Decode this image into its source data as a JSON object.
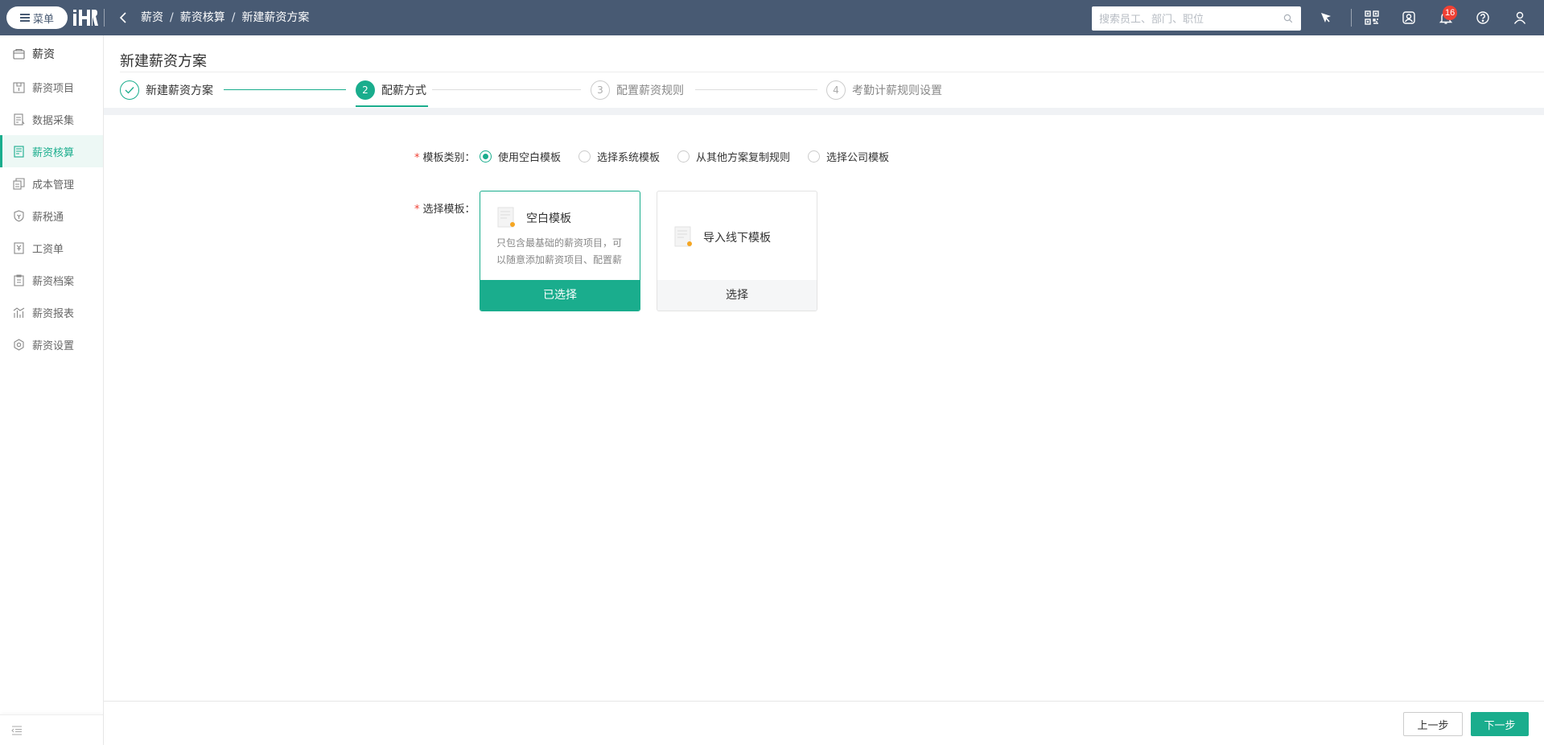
{
  "topbar": {
    "menu_label": "菜单",
    "breadcrumb": [
      "薪资",
      "薪资核算",
      "新建薪资方案"
    ],
    "breadcrumb_sep": "/",
    "search_placeholder": "搜索员工、部门、职位",
    "notification_count": "16",
    "icons": [
      "menu-icon",
      "back-icon",
      "search-icon",
      "pin-icon",
      "qrcode-icon",
      "contacts-icon",
      "bell-icon",
      "help-icon",
      "user-icon"
    ]
  },
  "sidebar": {
    "items": [
      {
        "label": "薪资",
        "icon": "salary-icon"
      },
      {
        "label": "薪资项目",
        "icon": "project-icon"
      },
      {
        "label": "数据采集",
        "icon": "data-icon"
      },
      {
        "label": "薪资核算",
        "icon": "calc-icon",
        "active": true
      },
      {
        "label": "成本管理",
        "icon": "cost-icon"
      },
      {
        "label": "薪税通",
        "icon": "tax-icon"
      },
      {
        "label": "工资单",
        "icon": "payslip-icon"
      },
      {
        "label": "薪资档案",
        "icon": "archive-icon"
      },
      {
        "label": "薪资报表",
        "icon": "report-icon"
      },
      {
        "label": "薪资设置",
        "icon": "settings-icon"
      }
    ]
  },
  "main": {
    "title": "新建薪资方案",
    "steps": [
      {
        "label": "新建薪资方案",
        "state": "done"
      },
      {
        "label": "配薪方式",
        "number": "2",
        "state": "active"
      },
      {
        "label": "配置薪资规则",
        "number": "3",
        "state": "todo"
      },
      {
        "label": "考勤计薪规则设置",
        "number": "4",
        "state": "todo"
      }
    ],
    "form": {
      "template_type_label": "模板类别：",
      "template_type_options": [
        "使用空白模板",
        "选择系统模板",
        "从其他方案复制规则",
        "选择公司模板"
      ],
      "template_type_selected": "使用空白模板",
      "select_template_label": "选择模板：",
      "required_mark": "*"
    },
    "cards": [
      {
        "title": "空白模板",
        "desc": "只包含最基础的薪资项目，可以随意添加薪资项目、配置薪",
        "footer": "已选择",
        "selected": true
      },
      {
        "title": "导入线下模板",
        "desc": "",
        "footer": "选择",
        "selected": false
      }
    ]
  },
  "footer": {
    "prev_label": "上一步",
    "next_label": "下一步"
  },
  "colors": {
    "topbar": "#485a73",
    "accent": "#1aad8d",
    "badge": "#f04134"
  }
}
